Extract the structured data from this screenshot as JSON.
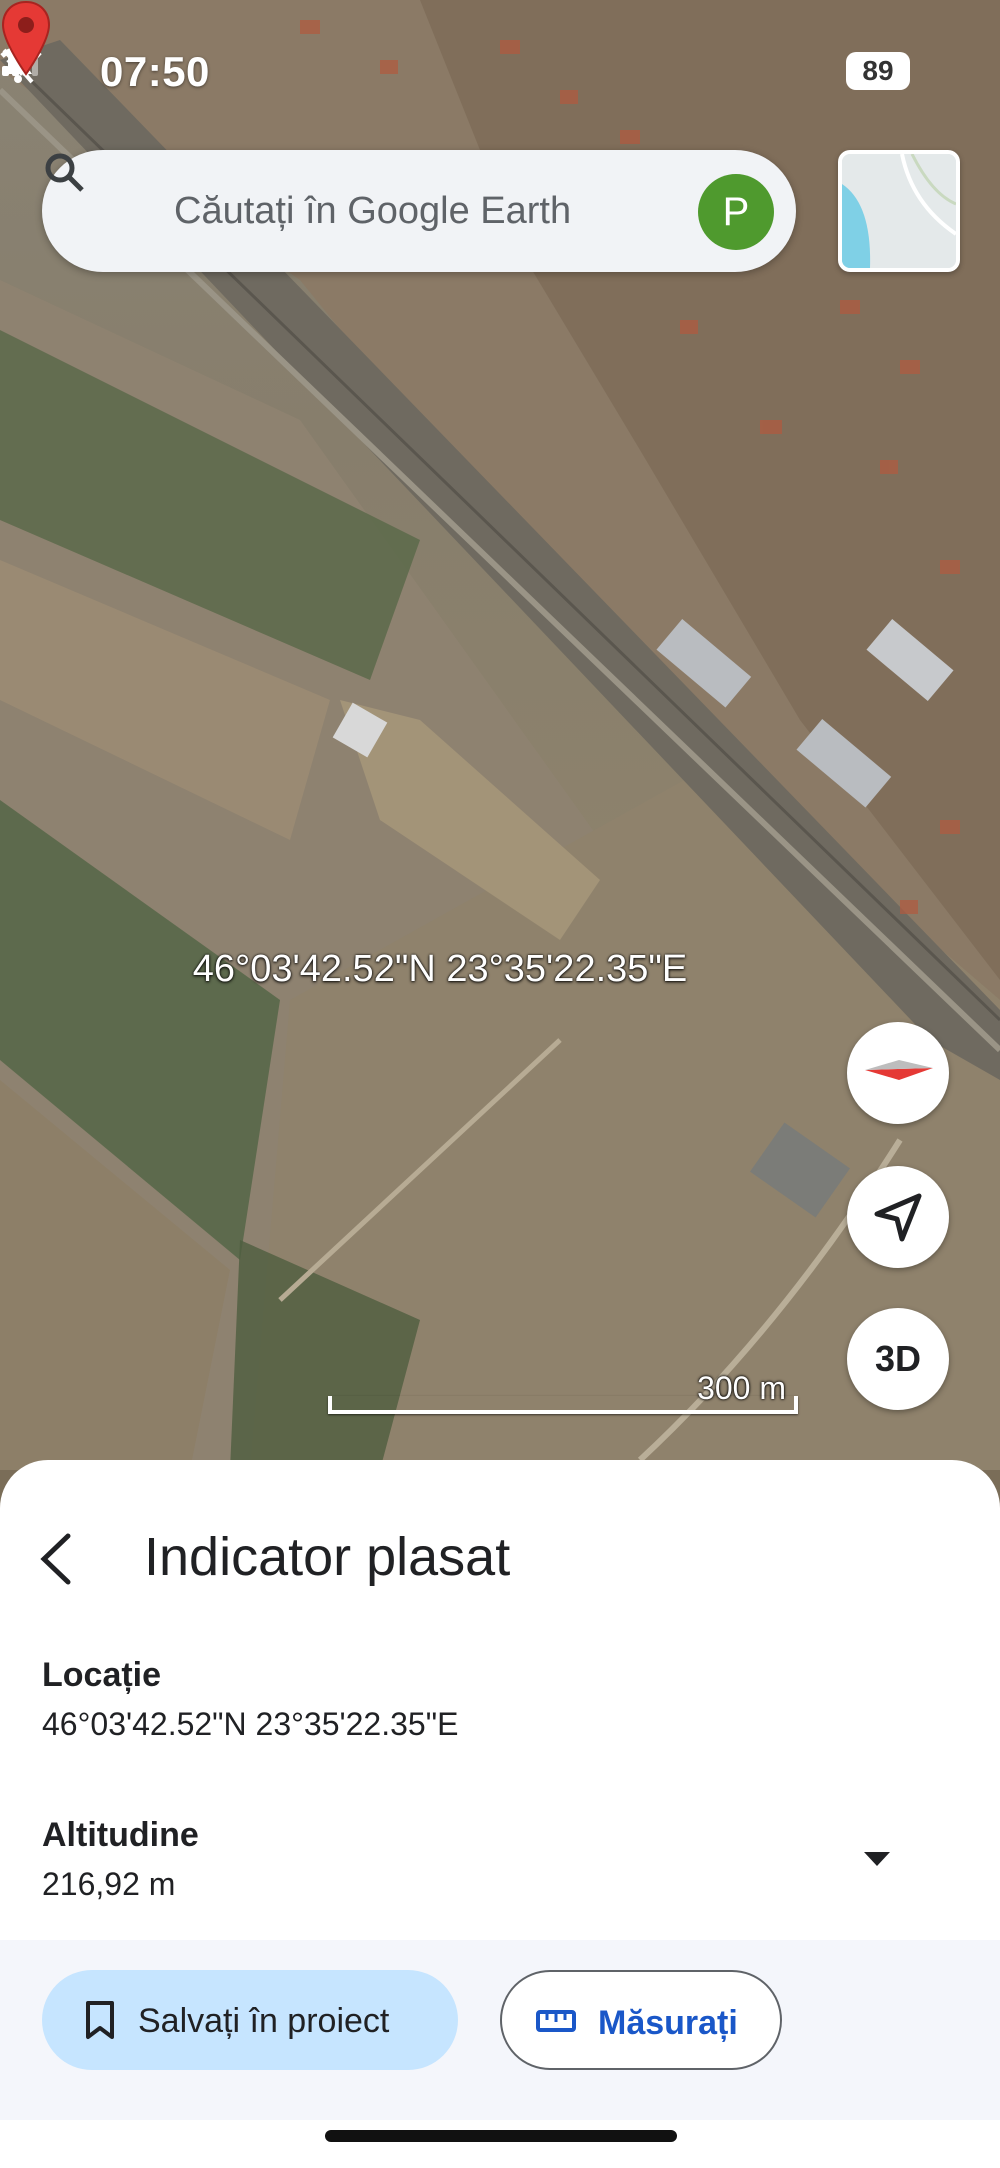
{
  "status_bar": {
    "time": "07:50",
    "battery": "89"
  },
  "search": {
    "placeholder": "Căutați în Google Earth",
    "avatar_letter": "P"
  },
  "map": {
    "coordinates_label": "46°03'42.52\"N 23°35'22.35\"E",
    "scale_label": "300 m",
    "btn_3d": "3D"
  },
  "sheet": {
    "title": "Indicator plasat",
    "location_label": "Locație",
    "location_value": "46°03'42.52\"N 23°35'22.35\"E",
    "altitude_label": "Altitudine",
    "altitude_value": "216,92 m"
  },
  "actions": {
    "save_label": "Salvați în proiect",
    "measure_label": "Măsurați"
  },
  "colors": {
    "accent": "#1a57c8",
    "save_bg": "#c6e5ff",
    "pin": "#e53935",
    "avatar": "#4f9a2e"
  },
  "icons": [
    "search-icon",
    "bell-off-icon",
    "signal-icon",
    "wifi-icon",
    "compass-icon",
    "my-location-icon",
    "back-icon",
    "dropdown-icon",
    "bookmark-icon",
    "ruler-icon"
  ]
}
